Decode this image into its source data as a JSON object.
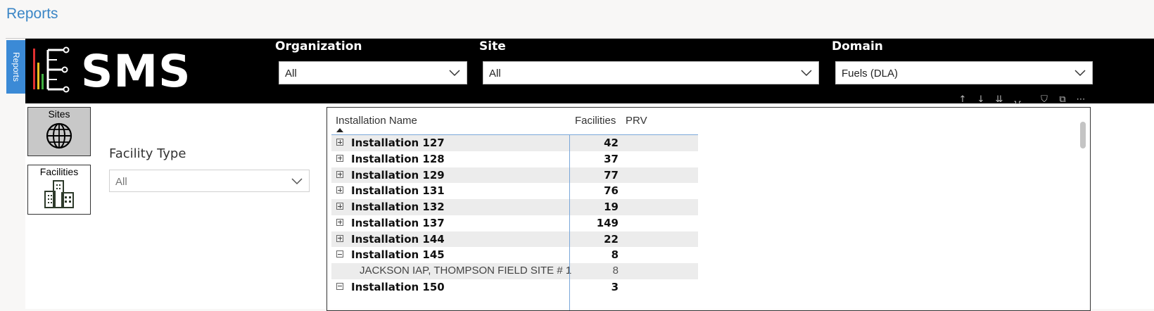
{
  "page": {
    "title": "Reports"
  },
  "side_tab": {
    "label": "Reports"
  },
  "logo": {
    "text": "SMS",
    "colors": [
      "#e03030",
      "#f0c020",
      "#40b040"
    ]
  },
  "filters": {
    "organization": {
      "label": "Organization",
      "value": "All"
    },
    "site": {
      "label": "Site",
      "value": "All"
    },
    "domain": {
      "label": "Domain",
      "value": "Fuels (DLA)"
    }
  },
  "visual_toolbar": [
    "arrow-up-icon",
    "arrow-down-icon",
    "double-arrow-down-icon",
    "expand-hierarchy-icon",
    "filter-icon",
    "focus-mode-icon",
    "more-options-icon"
  ],
  "nav_buttons": [
    {
      "label": "Sites",
      "icon": "globe-icon",
      "selected": true
    },
    {
      "label": "Facilities",
      "icon": "buildings-icon",
      "selected": false
    }
  ],
  "facility_type": {
    "label": "Facility Type",
    "value": "All"
  },
  "table": {
    "columns": [
      "Installation Name",
      "Facilities",
      "PRV"
    ],
    "rows": [
      {
        "name": "Installation 127",
        "facilities": "42",
        "prv": "",
        "expanded": false,
        "child": false
      },
      {
        "name": "Installation 128",
        "facilities": "37",
        "prv": "",
        "expanded": false,
        "child": false
      },
      {
        "name": "Installation 129",
        "facilities": "77",
        "prv": "",
        "expanded": false,
        "child": false
      },
      {
        "name": "Installation 131",
        "facilities": "76",
        "prv": "",
        "expanded": false,
        "child": false
      },
      {
        "name": "Installation 132",
        "facilities": "19",
        "prv": "",
        "expanded": false,
        "child": false
      },
      {
        "name": "Installation 137",
        "facilities": "149",
        "prv": "",
        "expanded": false,
        "child": false
      },
      {
        "name": "Installation 144",
        "facilities": "22",
        "prv": "",
        "expanded": false,
        "child": false
      },
      {
        "name": "Installation 145",
        "facilities": "8",
        "prv": "",
        "expanded": true,
        "child": false
      },
      {
        "name": "JACKSON IAP, THOMPSON FIELD SITE # 1",
        "facilities": "8",
        "prv": "",
        "expanded": false,
        "child": true
      },
      {
        "name": "Installation 150",
        "facilities": "3",
        "prv": "",
        "expanded": true,
        "child": false
      }
    ]
  },
  "colors": {
    "accent": "#3b86c6",
    "header_bg": "#000000",
    "row_shade": "#ececec",
    "selected_button": "#c8c8c8"
  }
}
